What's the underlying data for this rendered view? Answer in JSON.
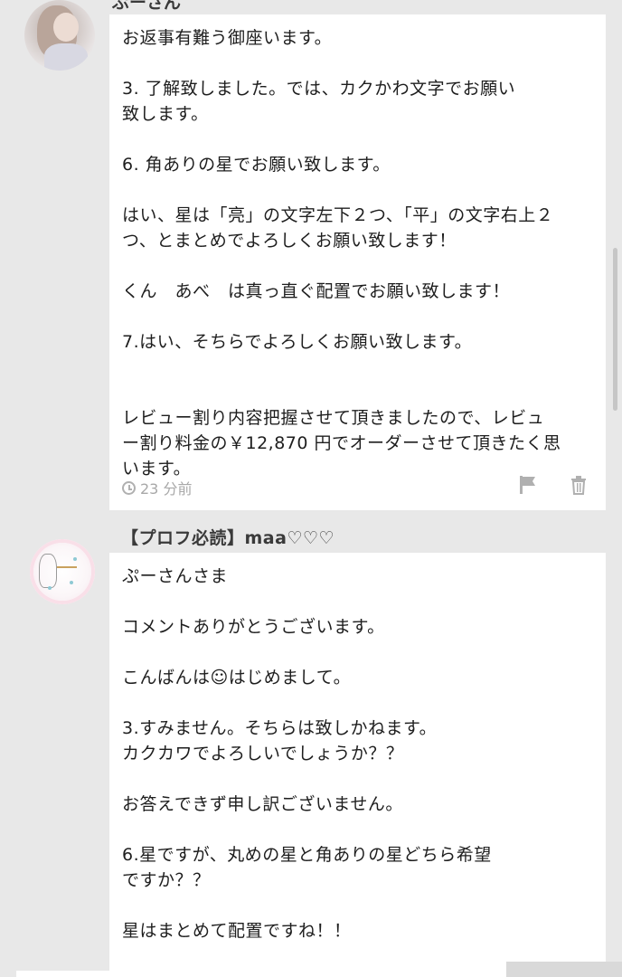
{
  "thread": {
    "top_author_fragment": "ぷーさん",
    "message_1": {
      "text": "お返事有難う御座います。\n\n3. 了解致しました。では、カクかわ文字でお願い\n致します。\n\n6. 角ありの星でお願い致します。\n\nはい、星は「亮」の文字左下２つ、「平」の文字右上２\nつ、とまとめでよろしくお願い致します！\n\nくん　あべ　は真っ直ぐ配置でお願い致します！\n\n7.はい、そちらでよろしくお願い致します。\n\n\nレビュー割り内容把握させて頂きましたので、レビュ\nー割り料金の￥12,870 円でオーダーさせて頂きたく思\nいます。",
      "time": "23 分前",
      "icons": [
        "clock-icon",
        "flag-icon",
        "trash-icon"
      ]
    },
    "message_2": {
      "author": "【プロフ必読】maa♡♡♡",
      "text": "ぷーさんさま\n\nコメントありがとうございます。\n\nこんばんは☺はじめまして。\n\n3.すみません。そちらは致しかねます。\nカクカワでよろしいでしょうか？？\n\nお答えできず申し訳ございません。\n\n6.星ですが、丸めの星と角ありの星どちら希望\nですか？？\n\n星はまとめて配置ですね！！"
    }
  },
  "colors": {
    "background": "#e8e8e8",
    "card": "#ffffff",
    "meta_text": "#a8a8a8",
    "icon": "#b0b0b0"
  }
}
